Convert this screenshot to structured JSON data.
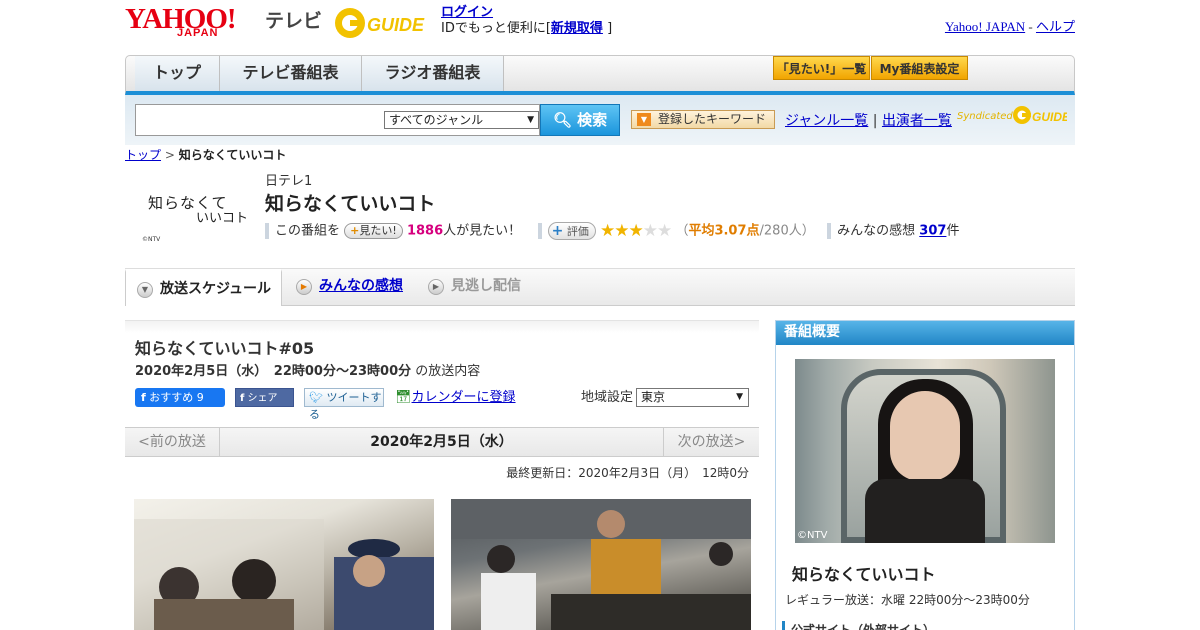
{
  "header": {
    "logo_yahoo": "YAHOO!",
    "logo_japan": "JAPAN",
    "logo_tv": "テレビ",
    "logo_gguide": "GUIDE",
    "login_link": "ログイン",
    "login_prefix": "IDでもっと便利に[",
    "register_link": "新規取得",
    "login_suffix": "]",
    "yahoo_japan_link": "Yahoo! JAPAN",
    "separator": "-",
    "help_link": "ヘルプ"
  },
  "nav": {
    "tabs": [
      {
        "label": "トップ"
      },
      {
        "label": "テレビ番組表"
      },
      {
        "label": "ラジオ番組表"
      }
    ],
    "mitai_list": "「見たい!」一覧",
    "my_bangumi": "My番組表設定"
  },
  "search": {
    "input_value": "",
    "genre_selected": "すべてのジャンル",
    "search_button": "検索",
    "keyword_button": "登録したキーワード",
    "genre_list_link": "ジャンル一覧",
    "divider": "|",
    "performer_list_link": "出演者一覧",
    "syndicated": "Syndicated"
  },
  "breadcrumb": {
    "top": "トップ",
    "sep": ">",
    "current": "知らなくていいコト"
  },
  "program": {
    "logo_line1": "知らなくて",
    "logo_line2": "いいコト",
    "logo_copyright": "©NTV",
    "channel": "日テレ1",
    "title": "知らなくていいコト",
    "this_program": "この番組を",
    "mitai_pill": "見たい!",
    "want_count": "1886",
    "want_suffix": "人が見たい！",
    "hyoka_pill": "評価",
    "rating_stars": 3,
    "rating_paren_open": "（",
    "avg_label": "平均3.07点",
    "rating_count": "/280人）",
    "impressions_prefix": "みんなの感想",
    "impressions_count": "307",
    "impressions_suffix": "件"
  },
  "subtabs": [
    {
      "label": "放送スケジュール"
    },
    {
      "label": "みんなの感想"
    },
    {
      "label": "見逃し配信"
    }
  ],
  "episode": {
    "title": "知らなくていいコト#05",
    "date_time": "2020年2月5日（水）　22時00分～23時00分",
    "date_suffix": "の放送内容",
    "fb_recommend": "おすすめ 9",
    "fb_share": "シェア",
    "tweet": "ツイートする",
    "calendar": "カレンダーに登録",
    "region_label": "地域設定",
    "region_selected": "東京",
    "prev": "<前の放送",
    "current_date": "2020年2月5日（水）",
    "next": "次の放送>",
    "updated": "最終更新日：2020年2月3日（月）　12時0分"
  },
  "sidebar": {
    "header": "番組概要",
    "poster_copyright": "©NTV",
    "title": "知らなくていいコト",
    "regular": "レギュラー放送：水曜 22時00分～23時00分",
    "official_site": "公式サイト（外部サイト）"
  },
  "colors": {
    "brand_red": "#e60012",
    "accent_blue": "#1c8fd6",
    "star": "#f1b400",
    "want_pink": "#d6007e"
  }
}
